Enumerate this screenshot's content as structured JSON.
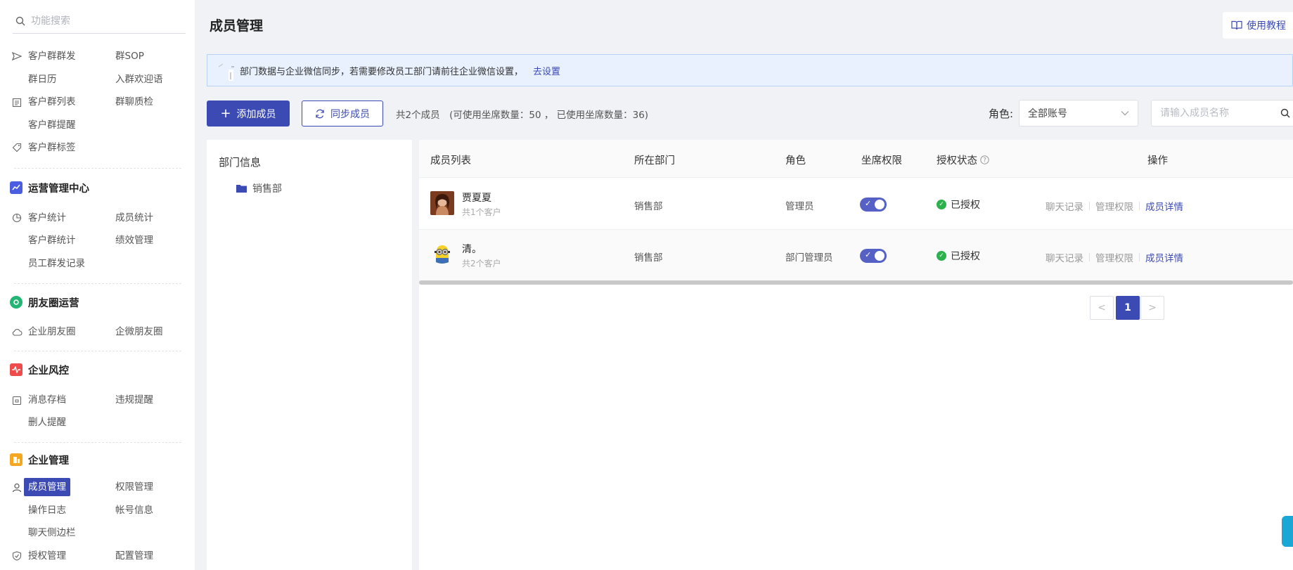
{
  "sidebar": {
    "search_placeholder": "功能搜索",
    "customer_group": {
      "items": [
        "客户群群发",
        "群SOP",
        "群日历",
        "入群欢迎语",
        "客户群列表",
        "群聊质检",
        "客户群提醒",
        "客户群标签"
      ]
    },
    "operations": {
      "title": "运营管理中心",
      "items": [
        "客户统计",
        "成员统计",
        "客户群统计",
        "绩效管理",
        "员工群发记录"
      ]
    },
    "moments": {
      "title": "朋友圈运营",
      "items": [
        "企业朋友圈",
        "企微朋友圈"
      ]
    },
    "risk": {
      "title": "企业风控",
      "items": [
        "消息存档",
        "违规提醒",
        "删人提醒"
      ]
    },
    "enterprise": {
      "title": "企业管理",
      "items": [
        "成员管理",
        "权限管理",
        "操作日志",
        "帐号信息",
        "聊天侧边栏",
        "授权管理",
        "配置管理"
      ]
    },
    "colors": {
      "operations_icon": "#4b5de0",
      "moments_icon": "#22b573",
      "risk_icon": "#f04b4b",
      "enterprise_icon": "#f5a623",
      "active_bg": "#3b4bb3"
    }
  },
  "header": {
    "title": "成员管理",
    "help_label": "使用教程"
  },
  "notice": {
    "text": "部门数据与企业微信同步，若需要修改员工部门请前往企业微信设置，",
    "link": "去设置"
  },
  "toolbar": {
    "add_label": "添加成员",
    "sync_label": "同步成员",
    "count_text": "共2个成员　(可使用坐席数量：50 ， 已使用坐席数量：36)",
    "role_label": "角色:",
    "role_value": "全部账号",
    "name_placeholder": "请输入成员名称"
  },
  "dept": {
    "title": "部门信息",
    "node": "销售部"
  },
  "table": {
    "headers": {
      "member": "成员列表",
      "dept": "所在部门",
      "role": "角色",
      "seat": "坐席权限",
      "auth": "授权状态",
      "ops": "操作"
    },
    "rows": [
      {
        "name": "贾夏夏",
        "sub": "共1个客户",
        "dept": "销售部",
        "role": "管理员",
        "seat_on": true,
        "auth": "已授权"
      },
      {
        "name": "清。",
        "sub": "共2个客户",
        "dept": "销售部",
        "role": "部门管理员",
        "seat_on": true,
        "auth": "已授权"
      }
    ],
    "ops": {
      "chat": "聊天记录",
      "perm": "管理权限",
      "detail": "成员详情"
    }
  },
  "pagination": {
    "prev": "<",
    "current": "1",
    "next": ">"
  }
}
